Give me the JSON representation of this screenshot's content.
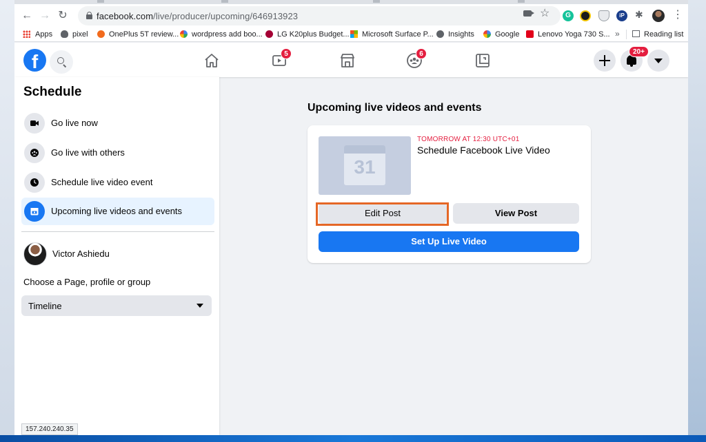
{
  "browser": {
    "url_host": "facebook.com",
    "url_path": "/live/producer/upcoming/646913923",
    "bookmarks": [
      {
        "label": "Apps"
      },
      {
        "label": "pixel"
      },
      {
        "label": "OnePlus 5T review..."
      },
      {
        "label": "wordpress add boo..."
      },
      {
        "label": "LG K20plus Budget..."
      },
      {
        "label": "Microsoft Surface P..."
      },
      {
        "label": "Insights"
      },
      {
        "label": "Google"
      },
      {
        "label": "Lenovo Yoga 730 S..."
      }
    ],
    "more_glyph": "»",
    "reading_list": "Reading list",
    "status_text": "157.240.240.35"
  },
  "header": {
    "logo_letter": "f",
    "watch_badge": "5",
    "groups_badge": "6",
    "notifications_badge": "20+"
  },
  "sidebar": {
    "title": "Schedule",
    "items": [
      {
        "label": "Go live now"
      },
      {
        "label": "Go live with others"
      },
      {
        "label": "Schedule live video event"
      },
      {
        "label": "Upcoming live videos and events"
      }
    ],
    "user_name": "Victor Ashiedu",
    "choose_label": "Choose a Page, profile or group",
    "selected_target": "Timeline"
  },
  "main": {
    "heading": "Upcoming live videos and events",
    "event": {
      "calendar_day": "31",
      "time": "TOMORROW AT 12:30 UTC+01",
      "title": "Schedule Facebook Live Video",
      "edit_label": "Edit Post",
      "view_label": "View Post",
      "setup_label": "Set Up Live Video"
    }
  },
  "colors": {
    "fb_blue": "#1877f2",
    "badge_red": "#e41e3f",
    "highlight_orange": "#e56726"
  }
}
